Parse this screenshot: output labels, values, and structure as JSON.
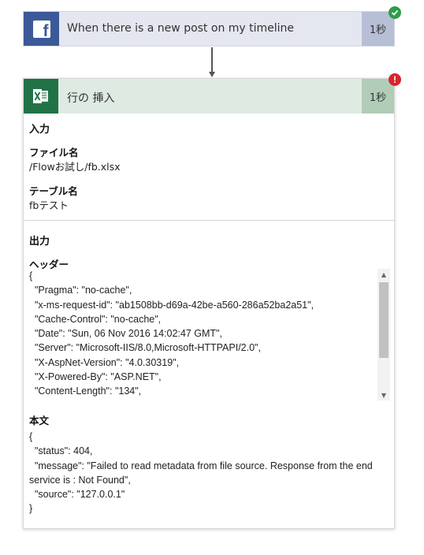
{
  "trigger": {
    "title": "When there is a new post on my timeline",
    "duration": "1秒",
    "status_color": "#2e9d48",
    "icon": "facebook-icon"
  },
  "action": {
    "title": "行の 挿入",
    "duration": "1秒",
    "status_color": "#d9232d",
    "status_symbol": "!",
    "icon": "excel-icon",
    "input": {
      "section_title": "入力",
      "file_label": "ファイル名",
      "file_value": "/Flowお試し/fb.xlsx",
      "table_label": "テーブル名",
      "table_value": "fbテスト"
    },
    "output": {
      "section_title": "出力",
      "headers_label": "ヘッダー",
      "headers_lines": [
        "{",
        "  \"Pragma\": \"no-cache\",",
        "  \"x-ms-request-id\": \"ab1508bb-d69a-42be-a560-286a52ba2a51\",",
        "  \"Cache-Control\": \"no-cache\",",
        "  \"Date\": \"Sun, 06 Nov 2016 14:02:47 GMT\",",
        "  \"Server\": \"Microsoft-IIS/8.0,Microsoft-HTTPAPI/2.0\",",
        "  \"X-AspNet-Version\": \"4.0.30319\",",
        "  \"X-Powered-By\": \"ASP.NET\",",
        "  \"Content-Length\": \"134\","
      ],
      "body_label": "本文",
      "body_lines": [
        "{",
        "  \"status\": 404,",
        "  \"message\": \"Failed to read metadata from file source. Response from the end service is : Not Found\",",
        "  \"source\": \"127.0.0.1\"",
        "}"
      ]
    }
  }
}
